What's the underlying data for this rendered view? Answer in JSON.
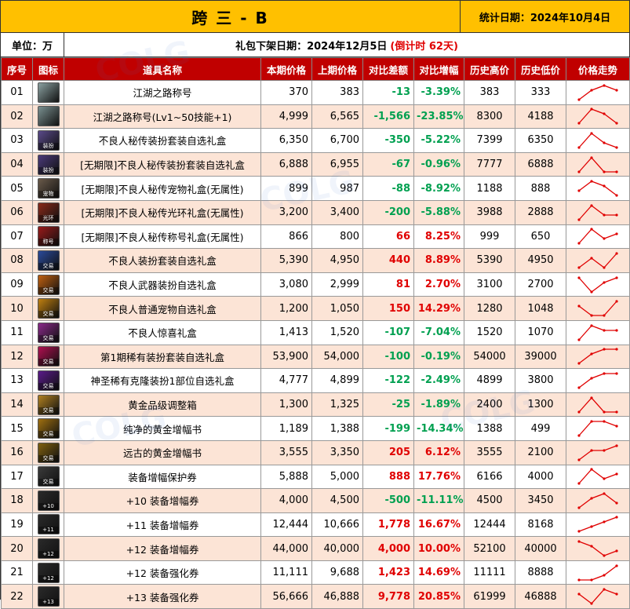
{
  "header": {
    "title": "跨 三 - B",
    "stat_date": "统计日期：2024年10月4日",
    "unit": "单位：万",
    "pkg_label": "礼包下架日期：2024年12月5日",
    "countdown": "(倒计时 62天)"
  },
  "columns": [
    "序号",
    "图标",
    "道具名称",
    "本期价格",
    "上期价格",
    "对比差额",
    "对比增幅",
    "历史高价",
    "历史低价",
    "价格走势"
  ],
  "rows": [
    {
      "id": "01",
      "name": "江湖之路称号",
      "cur": "370",
      "prev": "383",
      "diff": "-13",
      "pct": "-3.39%",
      "high": "383",
      "low": "333",
      "icon": "title-badge-icon",
      "color": "#8aa0a0",
      "tag": "",
      "trend": [
        1,
        3,
        4,
        3
      ]
    },
    {
      "id": "02",
      "name": "江湖之路称号(Lv1~50技能+1)",
      "cur": "4,999",
      "prev": "6,565",
      "diff": "-1,566",
      "pct": "-23.85%",
      "high": "8300",
      "low": "4188",
      "icon": "title-badge-icon",
      "color": "#7a9090",
      "tag": "",
      "trend": [
        1,
        4,
        3,
        1
      ]
    },
    {
      "id": "03",
      "name": "不良人秘传装扮套装自选礼盒",
      "cur": "6,350",
      "prev": "6,700",
      "diff": "-350",
      "pct": "-5.22%",
      "high": "7399",
      "low": "6350",
      "icon": "costume-box-icon",
      "color": "#5a4a8a",
      "tag": "装扮",
      "trend": [
        1,
        4,
        2,
        1
      ]
    },
    {
      "id": "04",
      "name": "[无期限]不良人秘传装扮套装自选礼盒",
      "cur": "6,888",
      "prev": "6,955",
      "diff": "-67",
      "pct": "-0.96%",
      "high": "7777",
      "low": "6888",
      "icon": "costume-box-icon",
      "color": "#4a3a7a",
      "tag": "装扮",
      "trend": [
        1,
        4,
        1,
        1
      ]
    },
    {
      "id": "05",
      "name": "[无期限]不良人秘传宠物礼盒(无属性)",
      "cur": "899",
      "prev": "987",
      "diff": "-88",
      "pct": "-8.92%",
      "high": "1188",
      "low": "888",
      "icon": "pet-box-icon",
      "color": "#6a5a4a",
      "tag": "宠物",
      "trend": [
        2,
        4,
        3,
        1
      ]
    },
    {
      "id": "06",
      "name": "[无期限]不良人秘传光环礼盒(无属性)",
      "cur": "3,200",
      "prev": "3,400",
      "diff": "-200",
      "pct": "-5.88%",
      "high": "3988",
      "low": "2888",
      "icon": "aura-box-icon",
      "color": "#8a2a1a",
      "tag": "光环",
      "trend": [
        1,
        4,
        2,
        2
      ]
    },
    {
      "id": "07",
      "name": "[无期限]不良人秘传称号礼盒(无属性)",
      "cur": "866",
      "prev": "800",
      "diff": "66",
      "pct": "8.25%",
      "high": "999",
      "low": "650",
      "icon": "title-box-icon",
      "color": "#9a1a1a",
      "tag": "称号",
      "trend": [
        1,
        4,
        2,
        3
      ]
    },
    {
      "id": "08",
      "name": "不良人装扮套装自选礼盒",
      "cur": "5,390",
      "prev": "4,950",
      "diff": "440",
      "pct": "8.89%",
      "high": "5390",
      "low": "4950",
      "icon": "gift-box-icon",
      "color": "#2a4a9a",
      "tag": "交易",
      "trend": [
        1,
        3,
        1,
        4
      ]
    },
    {
      "id": "09",
      "name": "不良人武器装扮自选礼盒",
      "cur": "3,080",
      "prev": "2,999",
      "diff": "81",
      "pct": "2.70%",
      "high": "3100",
      "low": "2700",
      "icon": "gift-box-icon",
      "color": "#c06010",
      "tag": "交易",
      "trend": [
        4,
        1,
        3,
        4
      ]
    },
    {
      "id": "10",
      "name": "不良人普通宠物自选礼盒",
      "cur": "1,200",
      "prev": "1,050",
      "diff": "150",
      "pct": "14.29%",
      "high": "1280",
      "low": "1048",
      "icon": "gift-box-icon",
      "color": "#c08010",
      "tag": "交易",
      "trend": [
        3,
        1,
        1,
        4
      ]
    },
    {
      "id": "11",
      "name": "不良人惊喜礼盒",
      "cur": "1,413",
      "prev": "1,520",
      "diff": "-107",
      "pct": "-7.04%",
      "high": "1520",
      "low": "1070",
      "icon": "gift-box-icon",
      "color": "#8a2a8a",
      "tag": "交易",
      "trend": [
        1,
        4,
        3,
        3
      ]
    },
    {
      "id": "12",
      "name": "第1期稀有装扮套装自选礼盒",
      "cur": "53,900",
      "prev": "54,000",
      "diff": "-100",
      "pct": "-0.19%",
      "high": "54000",
      "low": "39000",
      "icon": "gift-box-icon",
      "color": "#b01050",
      "tag": "交易",
      "trend": [
        1,
        3,
        4,
        4
      ]
    },
    {
      "id": "13",
      "name": "神圣稀有克隆装扮1部位自选礼盒",
      "cur": "4,777",
      "prev": "4,899",
      "diff": "-122",
      "pct": "-2.49%",
      "high": "4899",
      "low": "3800",
      "icon": "gift-box-icon",
      "color": "#5a1a8a",
      "tag": "交易",
      "trend": [
        1,
        3,
        4,
        4
      ]
    },
    {
      "id": "14",
      "name": "黄金品级调整箱",
      "cur": "1,300",
      "prev": "1,325",
      "diff": "-25",
      "pct": "-1.89%",
      "high": "2400",
      "low": "1300",
      "icon": "golden-box-icon",
      "color": "#b08020",
      "tag": "交易",
      "trend": [
        1,
        4,
        1,
        1
      ]
    },
    {
      "id": "15",
      "name": "纯净的黄金增幅书",
      "cur": "1,189",
      "prev": "1,388",
      "diff": "-199",
      "pct": "-14.34%",
      "high": "1388",
      "low": "499",
      "icon": "golden-book-icon",
      "color": "#a07010",
      "tag": "交易",
      "trend": [
        1,
        4,
        4,
        3
      ]
    },
    {
      "id": "16",
      "name": "远古的黄金增幅书",
      "cur": "3,555",
      "prev": "3,350",
      "diff": "205",
      "pct": "6.12%",
      "high": "3555",
      "low": "2100",
      "icon": "golden-book-icon",
      "color": "#806010",
      "tag": "交易",
      "trend": [
        1,
        3,
        3,
        4
      ]
    },
    {
      "id": "17",
      "name": "装备增幅保护券",
      "cur": "5,888",
      "prev": "5,000",
      "diff": "888",
      "pct": "17.76%",
      "high": "6166",
      "low": "4000",
      "icon": "protection-ticket-icon",
      "color": "#3a3a3a",
      "tag": "交易",
      "trend": [
        1,
        4,
        2,
        3
      ]
    },
    {
      "id": "18",
      "name": "+10 装备增幅券",
      "cur": "4,000",
      "prev": "4,500",
      "diff": "-500",
      "pct": "-11.11%",
      "high": "4500",
      "low": "3450",
      "icon": "amplify-ticket-icon",
      "color": "#2a2a2a",
      "tag": "+10",
      "trend": [
        1,
        3,
        4,
        2
      ]
    },
    {
      "id": "19",
      "name": "+11 装备增幅券",
      "cur": "12,444",
      "prev": "10,666",
      "diff": "1,778",
      "pct": "16.67%",
      "high": "12444",
      "low": "8168",
      "icon": "amplify-ticket-icon",
      "color": "#2a2a2a",
      "tag": "+11",
      "trend": [
        1,
        2,
        3,
        4
      ]
    },
    {
      "id": "20",
      "name": "+12 装备增幅券",
      "cur": "44,000",
      "prev": "40,000",
      "diff": "4,000",
      "pct": "10.00%",
      "high": "52100",
      "low": "40000",
      "icon": "amplify-ticket-icon",
      "color": "#2a2a2a",
      "tag": "+12",
      "trend": [
        4,
        3,
        1,
        2
      ]
    },
    {
      "id": "21",
      "name": "+12 装备强化券",
      "cur": "11,111",
      "prev": "9,688",
      "diff": "1,423",
      "pct": "14.69%",
      "high": "11111",
      "low": "8888",
      "icon": "reinforce-ticket-icon",
      "color": "#2a2a2a",
      "tag": "+12",
      "trend": [
        1,
        1,
        2,
        4
      ]
    },
    {
      "id": "22",
      "name": "+13 装备强化券",
      "cur": "56,666",
      "prev": "46,888",
      "diff": "9,778",
      "pct": "20.85%",
      "high": "61999",
      "low": "46888",
      "icon": "reinforce-ticket-icon",
      "color": "#2a2a2a",
      "tag": "+13",
      "trend": [
        3,
        1,
        4,
        3
      ]
    }
  ]
}
